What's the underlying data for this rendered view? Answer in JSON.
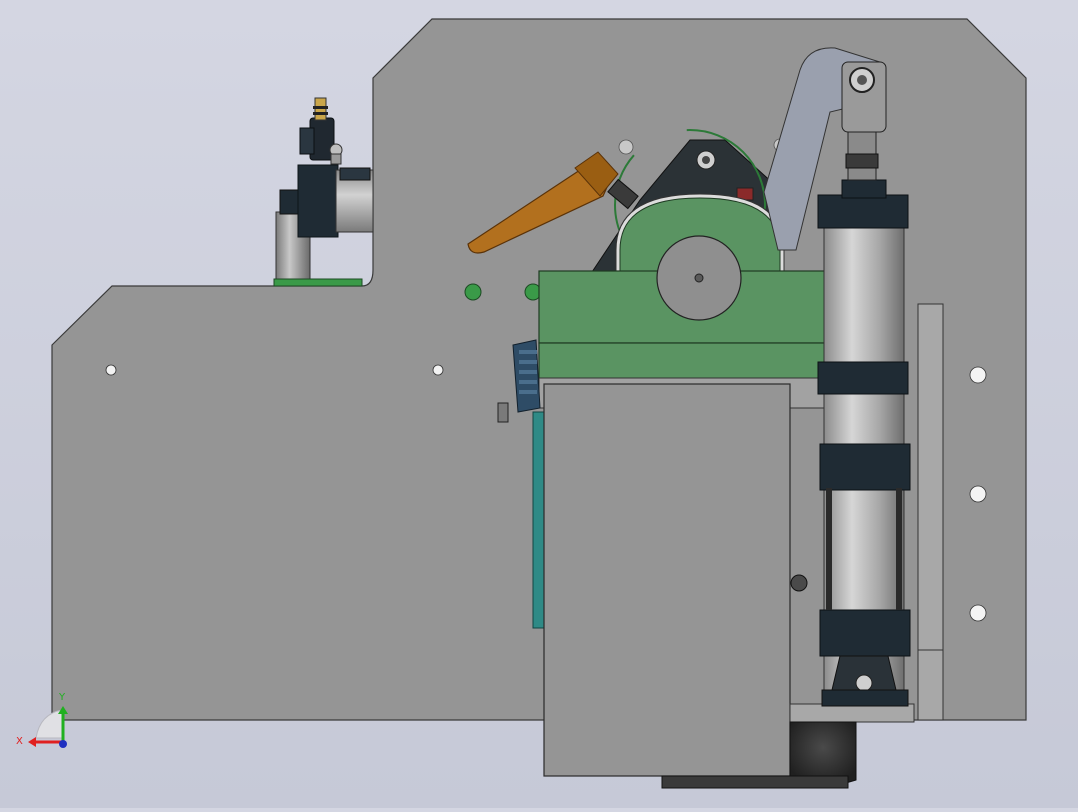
{
  "viewport": {
    "background_top": "#d4d6e2",
    "background_bottom": "#c6c9d7"
  },
  "colors": {
    "plate": "#959595",
    "plate_edge": "#3a3a3a",
    "green_block": "#5a9462",
    "cylinder_cap": "#1f2b34",
    "cylinder_body": "#b4b4b4",
    "handle": "#b2701e",
    "teal_part": "#2f8a86"
  },
  "triad": {
    "x_label": "X",
    "y_label": "Y",
    "x_color": "#e02020",
    "y_color": "#20b020",
    "z_color": "#2030c0"
  },
  "parts": {
    "base_plate": "base-plate",
    "green_bearing_block": "bearing-block",
    "pneumatic_cylinder": "pneumatic-cylinder",
    "clamp_lever": "clamp-lever",
    "lower_housing": "lower-housing"
  }
}
